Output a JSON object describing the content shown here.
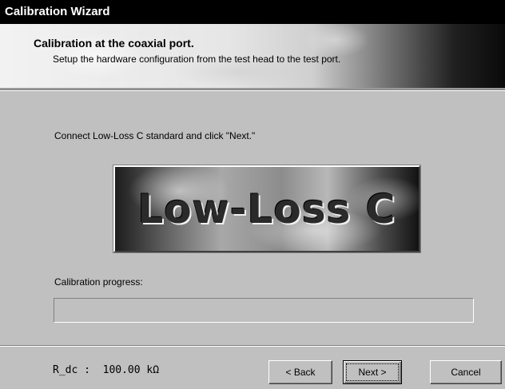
{
  "window": {
    "title": "Calibration Wizard"
  },
  "header": {
    "title": "Calibration at the coaxial port.",
    "subtitle": "Setup the hardware configuration from the test head to the test port."
  },
  "main": {
    "instruction": "Connect Low-Loss C standard and click \"Next.\"",
    "standard_image_label": "Low-Loss C",
    "progress_label": "Calibration progress:",
    "progress_value": 0
  },
  "footer": {
    "readout": "R_dc :  100.00 kΩ",
    "buttons": {
      "back": "< Back",
      "next": "Next >",
      "cancel": "Cancel"
    }
  },
  "colors": {
    "window_bg": "#c0c0c0",
    "titlebar_bg": "#000000",
    "titlebar_text": "#ffffff"
  }
}
